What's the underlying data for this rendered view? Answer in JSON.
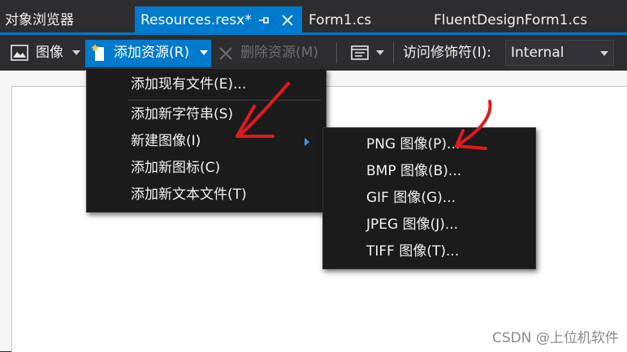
{
  "tabs": {
    "object_browser": "对象浏览器",
    "resources": "Resources.resx*",
    "form1": "Form1.cs",
    "fluent": "FluentDesignForm1.cs"
  },
  "toolbar": {
    "images_label": "图像",
    "add_resource_label": "添加资源(R)",
    "remove_resource_label": "删除资源(M)",
    "access_modifier_label": "访问修饰符(I):",
    "access_modifier_value": "Internal"
  },
  "menu": {
    "items": [
      "添加现有文件(E)...",
      "添加新字符串(S)",
      "新建图像(I)",
      "添加新图标(C)",
      "添加新文本文件(T)"
    ]
  },
  "submenu": {
    "items": [
      "PNG 图像(P)...",
      "BMP 图像(B)...",
      "GIF 图像(G)...",
      "JPEG 图像(J)...",
      "TIFF 图像(T)..."
    ]
  },
  "watermark": "CSDN @上位机软件",
  "colors": {
    "accent": "#007acc",
    "annotation": "#e0191f"
  }
}
